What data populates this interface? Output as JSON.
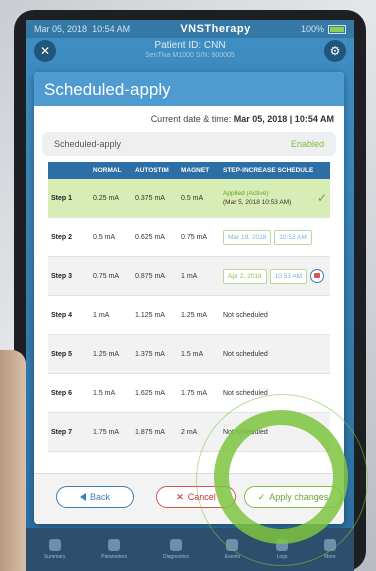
{
  "status_bar": {
    "date": "Mar 05, 2018",
    "time": "10:54 AM",
    "brand": "VNSTherapy",
    "battery": "100%",
    "battery_level": 1.0
  },
  "patient": {
    "id_label": "Patient ID: CNN",
    "sub": "SenTiva M1000 S/N: 900005"
  },
  "modal": {
    "title": "Scheduled-apply",
    "datetime_label": "Current date & time:",
    "datetime_value": "Mar 05, 2018 | 10:54 AM",
    "sa_label": "Scheduled-apply",
    "sa_status": "Enabled"
  },
  "table": {
    "headers": [
      "",
      "NORMAL",
      "AUTOSTIM",
      "MAGNET",
      "STEP-INCREASE SCHEDULE"
    ],
    "rows": [
      {
        "step": "Step 1",
        "normal": "0.25 mA",
        "autostim": "0.375 mA",
        "magnet": "0.5 mA",
        "schedule_applied": "Applied (Active)",
        "schedule_applied_date": "(Mar 5, 2018 10:53 AM)"
      },
      {
        "step": "Step 2",
        "normal": "0.5 mA",
        "autostim": "0.625 mA",
        "magnet": "0.75 mA",
        "date": "Mar 19, 2018",
        "time": "10:53 AM"
      },
      {
        "step": "Step 3",
        "normal": "0.75 mA",
        "autostim": "0.875 mA",
        "magnet": "1 mA",
        "date": "Apr 2, 2018",
        "time": "10:53 AM"
      },
      {
        "step": "Step 4",
        "normal": "1 mA",
        "autostim": "1.125 mA",
        "magnet": "1.25 mA",
        "schedule": "Not scheduled"
      },
      {
        "step": "Step 5",
        "normal": "1.25 mA",
        "autostim": "1.375 mA",
        "magnet": "1.5 mA",
        "schedule": "Not scheduled"
      },
      {
        "step": "Step 6",
        "normal": "1.5 mA",
        "autostim": "1.625 mA",
        "magnet": "1.75 mA",
        "schedule": "Not scheduled"
      },
      {
        "step": "Step 7",
        "normal": "1.75 mA",
        "autostim": "1.875 mA",
        "magnet": "2 mA",
        "schedule": "Not scheduled"
      }
    ]
  },
  "footer": {
    "back": "Back",
    "cancel": "Cancel",
    "apply": "Apply changes"
  },
  "tabs": [
    "Summary",
    "Parameters",
    "Diagnostics",
    "Events",
    "Logs",
    "More"
  ],
  "colors": {
    "accent": "#4d9bd0",
    "header": "#2b6fa6",
    "success": "#7dbf3b",
    "danger": "#d9534f"
  },
  "icons": {
    "back": "chevron-left-icon",
    "cancel": "x-icon",
    "apply": "check-icon",
    "calendar": "calendar-icon"
  }
}
